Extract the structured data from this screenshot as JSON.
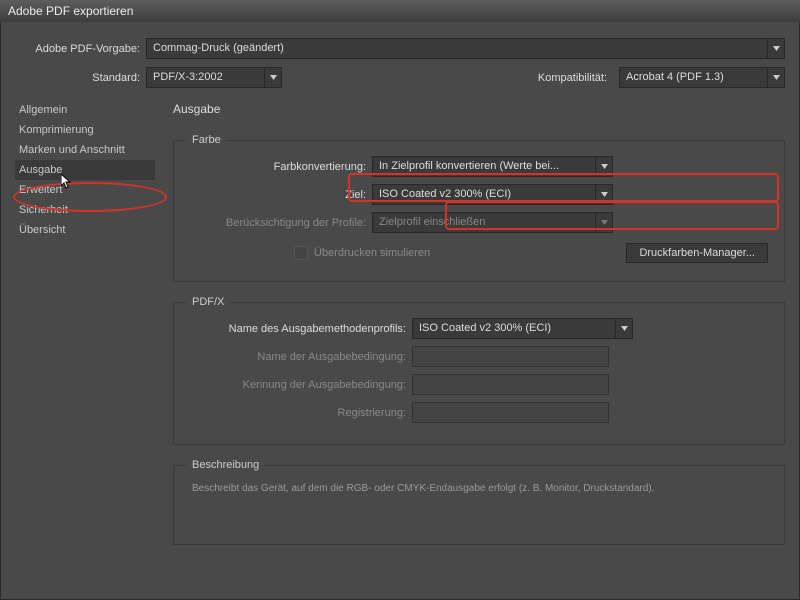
{
  "window": {
    "title": "Adobe PDF exportieren"
  },
  "topbar": {
    "preset_label": "Adobe PDF-Vorgabe:",
    "preset_value": "Commag-Druck (geändert)",
    "standard_label": "Standard:",
    "standard_value": "PDF/X-3:2002",
    "compat_label": "Kompatibilität:",
    "compat_value": "Acrobat 4 (PDF 1.3)"
  },
  "sidebar": {
    "items": [
      {
        "label": "Allgemein"
      },
      {
        "label": "Komprimierung"
      },
      {
        "label": "Marken und Anschnitt"
      },
      {
        "label": "Ausgabe"
      },
      {
        "label": "Erweitert"
      },
      {
        "label": "Sicherheit"
      },
      {
        "label": "Übersicht"
      }
    ]
  },
  "main": {
    "heading": "Ausgabe",
    "farbe": {
      "legend": "Farbe",
      "konvert_label": "Farbkonvertierung:",
      "konvert_value": "In Zielprofil konvertieren (Werte bei...",
      "ziel_label": "Ziel:",
      "ziel_value": "ISO Coated v2 300% (ECI)",
      "profile_label": "Berücksichtigung der Profile:",
      "profile_value": "Zielprofil einschließen",
      "overprint_label": "Überdrucken simulieren",
      "inkmgr_btn": "Druckfarben-Manager..."
    },
    "pdfx": {
      "legend": "PDF/X",
      "out_profile_label": "Name des Ausgabemethodenprofils:",
      "out_profile_value": "ISO Coated v2 300% (ECI)",
      "cond_name_label": "Name der Ausgabebedingung:",
      "cond_id_label": "Kennung der Ausgabebedingung:",
      "reg_label": "Registrierung:"
    },
    "desc": {
      "legend": "Beschreibung",
      "text": "Beschreibt das Gerät, auf dem die RGB- oder CMYK-Endausgabe erfolgt (z. B. Monitor, Druckstandard)."
    }
  }
}
